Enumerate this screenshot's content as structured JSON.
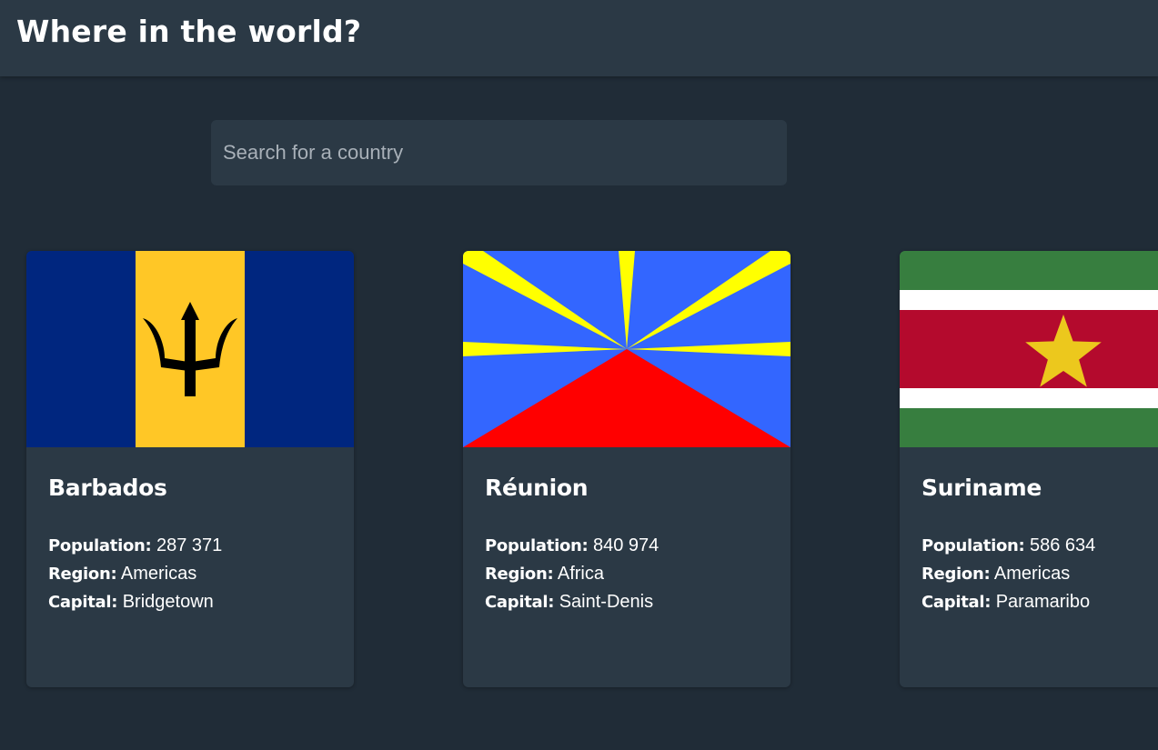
{
  "header": {
    "title": "Where in the world?"
  },
  "search": {
    "placeholder": "Search for a country",
    "value": ""
  },
  "labels": {
    "population": "Population:",
    "region": "Region:",
    "capital": "Capital:"
  },
  "countries": [
    {
      "name": "Barbados",
      "population": "287 371",
      "region": "Americas",
      "capital": "Bridgetown",
      "flag_icon": "barbados-flag",
      "colors": {
        "blue": "#00267f",
        "gold": "#ffc726",
        "black": "#000000"
      }
    },
    {
      "name": "Réunion",
      "population": "840 974",
      "region": "Africa",
      "capital": "Saint-Denis",
      "flag_icon": "reunion-flag",
      "colors": {
        "blue": "#3366ff",
        "yellow": "#ffff00",
        "red": "#ff0000"
      }
    },
    {
      "name": "Suriname",
      "population": "586 634",
      "region": "Americas",
      "capital": "Paramaribo",
      "flag_icon": "suriname-flag",
      "colors": {
        "green": "#377e3f",
        "white": "#ffffff",
        "red": "#b40a2d",
        "star": "#ecc81d"
      }
    }
  ],
  "theme": {
    "background": "#202c37",
    "elements": "#2b3945",
    "text": "#ffffff"
  }
}
